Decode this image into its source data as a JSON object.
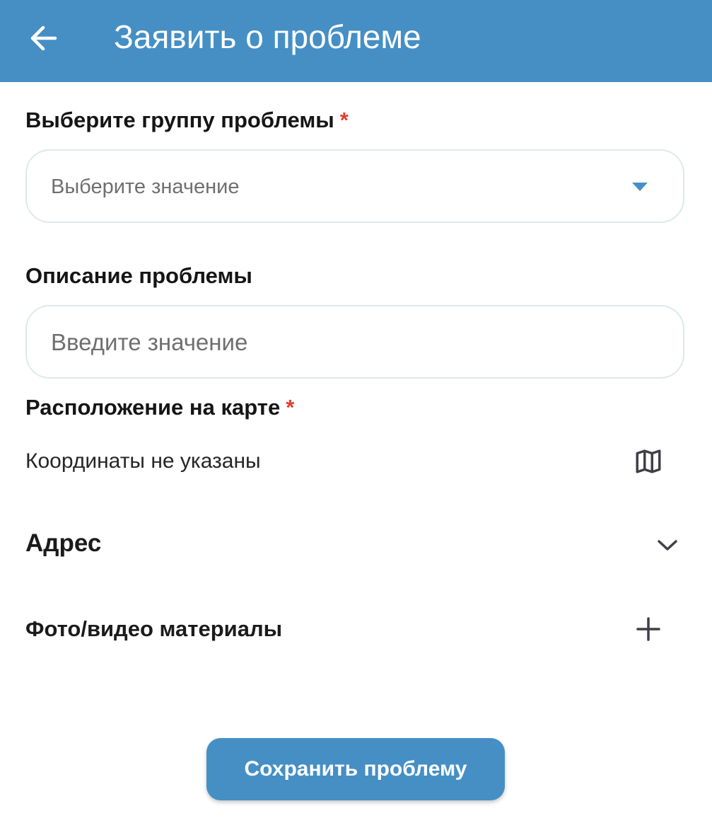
{
  "header": {
    "title": "Заявить о проблеме",
    "back_icon": "arrow-left-icon",
    "background": "#458fc5"
  },
  "problem_group": {
    "label": "Выберите группу проблемы",
    "required_mark": "*",
    "placeholder": "Выберите значение",
    "dropdown_icon": "caret-down-icon"
  },
  "description": {
    "label": "Описание проблемы",
    "placeholder": "Введите значение"
  },
  "location": {
    "label": "Расположение на карте",
    "required_mark": "*",
    "value": "Координаты не указаны",
    "map_icon": "map-icon"
  },
  "address": {
    "label": "Адрес",
    "expand_icon": "chevron-down-icon"
  },
  "media": {
    "label": "Фото/видео материалы",
    "add_icon": "plus-icon"
  },
  "actions": {
    "save_label": "Сохранить проблему"
  },
  "colors": {
    "accent": "#458fc5",
    "required": "#e53c2f"
  }
}
